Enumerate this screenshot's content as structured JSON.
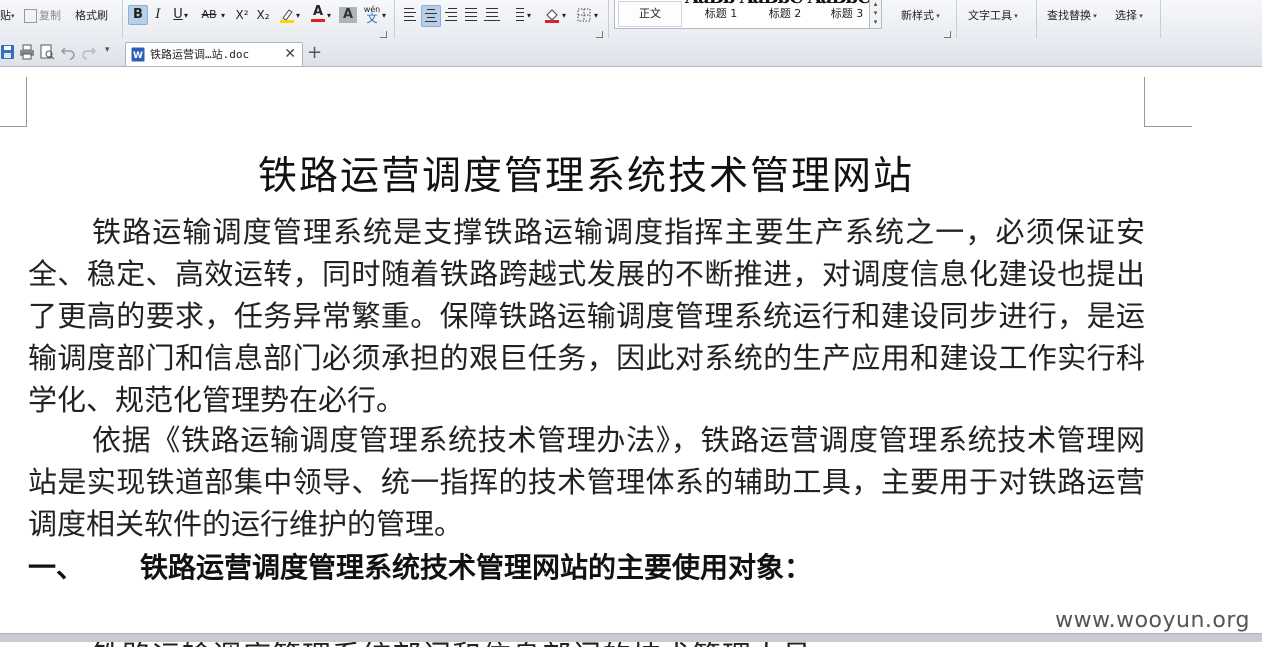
{
  "ribbon": {
    "paste_partial": "贴",
    "copy_label": "复制",
    "format_painter_label": "格式刷",
    "bold": "B",
    "italic": "I",
    "underline": "U",
    "strikethrough": "AB",
    "superscript": "X²",
    "subscript": "X₂",
    "font_color_letter": "A",
    "char_shade_letter": "A",
    "pinyin_label": "wén",
    "style_gallery": [
      "正文",
      "标题 1",
      "标题 2",
      "标题 3"
    ],
    "new_style_label": "新样式",
    "text_tools_label": "文字工具",
    "find_replace_label": "查找替换",
    "select_label": "选择",
    "highlight_color": "#f5d800",
    "font_color": "#e02020",
    "fill_color": "#cc2a2a"
  },
  "tabbar": {
    "doc_tab_label": "铁路运营调…站.doc",
    "new_tab": "+",
    "close_glyph": "✕"
  },
  "document": {
    "title": "铁路运营调度管理系统技术管理网站",
    "paragraph1": "铁路运输调度管理系统是支撑铁路运输调度指挥主要生产系统之一，必须保证安全、稳定、高效运转，同时随着铁路跨越式发展的不断推进，对调度信息化建设也提出了更高的要求，任务异常繁重。保障铁路运输调度管理系统运行和建设同步进行，是运输调度部门和信息部门必须承担的艰巨任务，因此对系统的生产应用和建设工作实行科学化、规范化管理势在必行。",
    "paragraph2": "依据《铁路运输调度管理系统技术管理办法》，铁路运营调度管理系统技术管理网站是实现铁道部集中领导、统一指挥的技术管理体系的辅助工具，主要用于对铁路运营调度相关软件的运行维护的管理。",
    "heading1_number": "一、",
    "heading1_text": "铁路运营调度管理系统技术管理网站的主要使用对象：",
    "cut_line": "铁路运输调度管理系统部门和信息部门的技术管理人员"
  },
  "watermark": "www.wooyun.org"
}
